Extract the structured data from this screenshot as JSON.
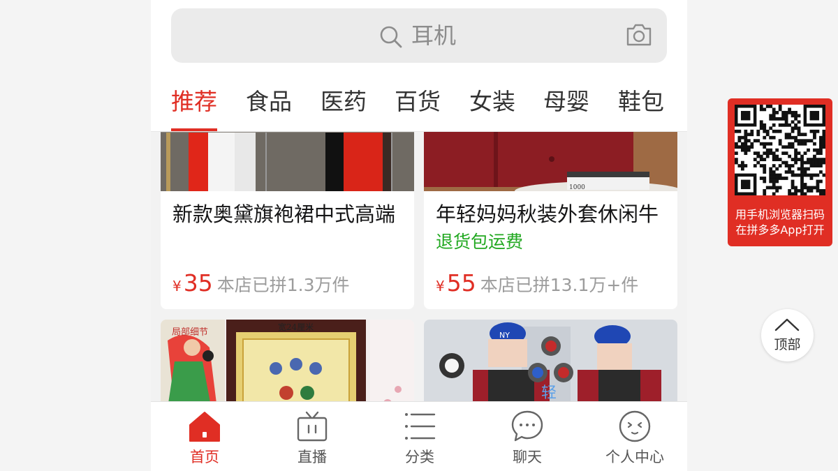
{
  "search": {
    "placeholder": "耳机"
  },
  "tabs": [
    {
      "label": "推荐",
      "active": true
    },
    {
      "label": "食品"
    },
    {
      "label": "医药"
    },
    {
      "label": "百货"
    },
    {
      "label": "女装"
    },
    {
      "label": "母婴"
    },
    {
      "label": "鞋包"
    }
  ],
  "products": [
    {
      "title": "新款奥黛旗袍裙中式高端",
      "tag": "",
      "currency": "¥",
      "price": "35",
      "sold": "本店已拼1.3万件"
    },
    {
      "title": "年轻妈妈秋装外套休闲牛",
      "tag": "退货包运费",
      "currency": "¥",
      "price": "55",
      "sold": "本店已拼13.1万+件"
    },
    {
      "image_text": [
        "局部细节",
        "宽24厘米"
      ]
    },
    {
      "image_text": [
        "NY",
        "轻"
      ]
    }
  ],
  "bottom_nav": [
    {
      "label": "首页",
      "icon": "home-icon",
      "active": true
    },
    {
      "label": "直播",
      "icon": "tv-icon"
    },
    {
      "label": "分类",
      "icon": "list-icon"
    },
    {
      "label": "聊天",
      "icon": "chat-bubble-icon"
    },
    {
      "label": "个人中心",
      "icon": "profile-face-icon"
    }
  ],
  "qr_panel": {
    "line1": "用手机浏览器扫码",
    "line2": "在拼多多App打开"
  },
  "back_to_top": {
    "label": "顶部"
  },
  "colors": {
    "accent": "#e02e24",
    "tag_green": "#21a820"
  }
}
